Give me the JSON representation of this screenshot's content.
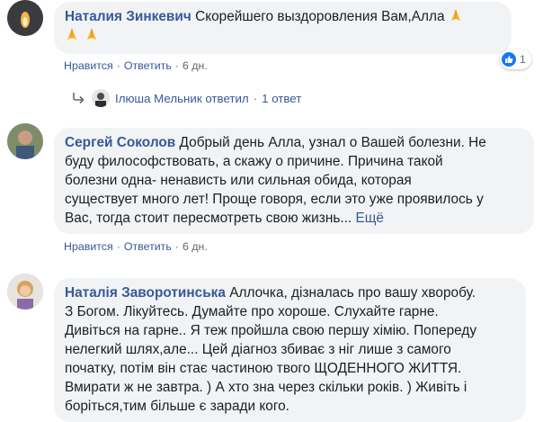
{
  "comments": [
    {
      "author": "Наталия Зинкевич",
      "text_lines": [
        "Скорейшего выздоровления Вам,Алла"
      ],
      "emoji_line2": "pray pray",
      "actions": {
        "like": "Нравится",
        "reply": "Ответить",
        "time": "6 дн."
      },
      "reaction": {
        "icon": "like-icon",
        "count": "1"
      },
      "reply_summary": {
        "label": "Ілюша Мельник ответил",
        "sep": "·",
        "count": "1 ответ"
      }
    },
    {
      "author": "Сергей Соколов",
      "text_lines": [
        "Добрый день Алла, узнал о Вашей болезни. Не",
        "буду философствовать, а скажу о причине. Причина такой",
        "болезни одна- ненависть или сильная обида, которая",
        "существует много лет! Проще говоря, если это уже проявилось у",
        "Вас, тогда стоит пересмотреть свою жизнь..."
      ],
      "more": "Ещё",
      "actions": {
        "like": "Нравится",
        "reply": "Ответить",
        "time": "6 дн."
      }
    },
    {
      "author": "Наталія Заворотинська",
      "text_lines": [
        "Аллочка, дізналась про вашу хворобу.",
        "З Богом. Лікуйтесь. Думайте про хороше. Слухайте гарне.",
        "Дивіться на гарне.. Я теж пройшла свою першу хімію. Попереду",
        "нелегкий шлях,але... Цей діагноз збиває з ніг лише з самого",
        "початку, потім він стає частиною твого ЩОДЕННОГО ЖИТТЯ.",
        "Вмирати ж не завтра. ) А хто зна через скільки років. ) Живіть і",
        "боріться,тим більше є заради кого."
      ]
    }
  ],
  "colors": {
    "link": "#385898",
    "bubble": "#f2f3f5",
    "meta": "#606770",
    "like": "#1877f2"
  }
}
